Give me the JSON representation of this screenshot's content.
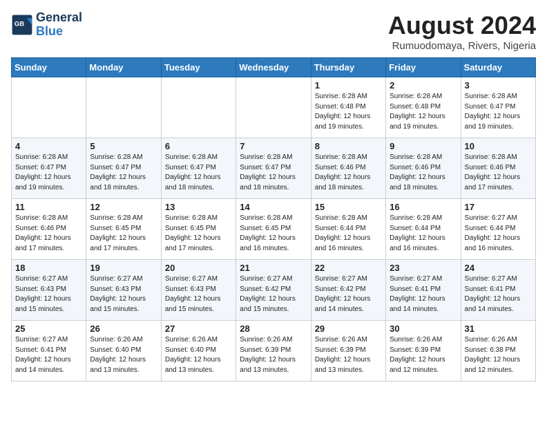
{
  "header": {
    "logo_line1": "General",
    "logo_line2": "Blue",
    "title": "August 2024",
    "subtitle": "Rumuodomaya, Rivers, Nigeria"
  },
  "weekdays": [
    "Sunday",
    "Monday",
    "Tuesday",
    "Wednesday",
    "Thursday",
    "Friday",
    "Saturday"
  ],
  "weeks": [
    [
      {
        "day": "",
        "info": ""
      },
      {
        "day": "",
        "info": ""
      },
      {
        "day": "",
        "info": ""
      },
      {
        "day": "",
        "info": ""
      },
      {
        "day": "1",
        "info": "Sunrise: 6:28 AM\nSunset: 6:48 PM\nDaylight: 12 hours\nand 19 minutes."
      },
      {
        "day": "2",
        "info": "Sunrise: 6:28 AM\nSunset: 6:48 PM\nDaylight: 12 hours\nand 19 minutes."
      },
      {
        "day": "3",
        "info": "Sunrise: 6:28 AM\nSunset: 6:47 PM\nDaylight: 12 hours\nand 19 minutes."
      }
    ],
    [
      {
        "day": "4",
        "info": "Sunrise: 6:28 AM\nSunset: 6:47 PM\nDaylight: 12 hours\nand 19 minutes."
      },
      {
        "day": "5",
        "info": "Sunrise: 6:28 AM\nSunset: 6:47 PM\nDaylight: 12 hours\nand 18 minutes."
      },
      {
        "day": "6",
        "info": "Sunrise: 6:28 AM\nSunset: 6:47 PM\nDaylight: 12 hours\nand 18 minutes."
      },
      {
        "day": "7",
        "info": "Sunrise: 6:28 AM\nSunset: 6:47 PM\nDaylight: 12 hours\nand 18 minutes."
      },
      {
        "day": "8",
        "info": "Sunrise: 6:28 AM\nSunset: 6:46 PM\nDaylight: 12 hours\nand 18 minutes."
      },
      {
        "day": "9",
        "info": "Sunrise: 6:28 AM\nSunset: 6:46 PM\nDaylight: 12 hours\nand 18 minutes."
      },
      {
        "day": "10",
        "info": "Sunrise: 6:28 AM\nSunset: 6:46 PM\nDaylight: 12 hours\nand 17 minutes."
      }
    ],
    [
      {
        "day": "11",
        "info": "Sunrise: 6:28 AM\nSunset: 6:46 PM\nDaylight: 12 hours\nand 17 minutes."
      },
      {
        "day": "12",
        "info": "Sunrise: 6:28 AM\nSunset: 6:45 PM\nDaylight: 12 hours\nand 17 minutes."
      },
      {
        "day": "13",
        "info": "Sunrise: 6:28 AM\nSunset: 6:45 PM\nDaylight: 12 hours\nand 17 minutes."
      },
      {
        "day": "14",
        "info": "Sunrise: 6:28 AM\nSunset: 6:45 PM\nDaylight: 12 hours\nand 16 minutes."
      },
      {
        "day": "15",
        "info": "Sunrise: 6:28 AM\nSunset: 6:44 PM\nDaylight: 12 hours\nand 16 minutes."
      },
      {
        "day": "16",
        "info": "Sunrise: 6:28 AM\nSunset: 6:44 PM\nDaylight: 12 hours\nand 16 minutes."
      },
      {
        "day": "17",
        "info": "Sunrise: 6:27 AM\nSunset: 6:44 PM\nDaylight: 12 hours\nand 16 minutes."
      }
    ],
    [
      {
        "day": "18",
        "info": "Sunrise: 6:27 AM\nSunset: 6:43 PM\nDaylight: 12 hours\nand 15 minutes."
      },
      {
        "day": "19",
        "info": "Sunrise: 6:27 AM\nSunset: 6:43 PM\nDaylight: 12 hours\nand 15 minutes."
      },
      {
        "day": "20",
        "info": "Sunrise: 6:27 AM\nSunset: 6:43 PM\nDaylight: 12 hours\nand 15 minutes."
      },
      {
        "day": "21",
        "info": "Sunrise: 6:27 AM\nSunset: 6:42 PM\nDaylight: 12 hours\nand 15 minutes."
      },
      {
        "day": "22",
        "info": "Sunrise: 6:27 AM\nSunset: 6:42 PM\nDaylight: 12 hours\nand 14 minutes."
      },
      {
        "day": "23",
        "info": "Sunrise: 6:27 AM\nSunset: 6:41 PM\nDaylight: 12 hours\nand 14 minutes."
      },
      {
        "day": "24",
        "info": "Sunrise: 6:27 AM\nSunset: 6:41 PM\nDaylight: 12 hours\nand 14 minutes."
      }
    ],
    [
      {
        "day": "25",
        "info": "Sunrise: 6:27 AM\nSunset: 6:41 PM\nDaylight: 12 hours\nand 14 minutes."
      },
      {
        "day": "26",
        "info": "Sunrise: 6:26 AM\nSunset: 6:40 PM\nDaylight: 12 hours\nand 13 minutes."
      },
      {
        "day": "27",
        "info": "Sunrise: 6:26 AM\nSunset: 6:40 PM\nDaylight: 12 hours\nand 13 minutes."
      },
      {
        "day": "28",
        "info": "Sunrise: 6:26 AM\nSunset: 6:39 PM\nDaylight: 12 hours\nand 13 minutes."
      },
      {
        "day": "29",
        "info": "Sunrise: 6:26 AM\nSunset: 6:39 PM\nDaylight: 12 hours\nand 13 minutes."
      },
      {
        "day": "30",
        "info": "Sunrise: 6:26 AM\nSunset: 6:39 PM\nDaylight: 12 hours\nand 12 minutes."
      },
      {
        "day": "31",
        "info": "Sunrise: 6:26 AM\nSunset: 6:38 PM\nDaylight: 12 hours\nand 12 minutes."
      }
    ]
  ]
}
